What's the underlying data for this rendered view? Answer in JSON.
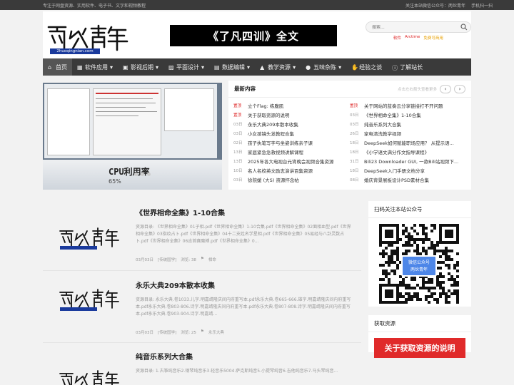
{
  "topbar": {
    "left": "专注于网盘资源、实用软件、电子书、文字和视频教程",
    "wechat": "关注本站微信公众号：两伙青年",
    "mobile": "手机扫一扫"
  },
  "header": {
    "logo_text": "两伙青年",
    "logo_sub": "2huoqingnian.com",
    "banner": "《了凡四训》全文",
    "search_placeholder": "搜索...",
    "hot_tags": [
      "软件",
      "Arctime",
      "免费可商用"
    ]
  },
  "nav": [
    {
      "label": "首页",
      "icon": "home-icon",
      "caret": ""
    },
    {
      "label": "软件应用",
      "icon": "windows-icon",
      "caret": "▾"
    },
    {
      "label": "影视后期",
      "icon": "film-icon",
      "caret": "▾"
    },
    {
      "label": "平面设计",
      "icon": "image-icon",
      "caret": "▾"
    },
    {
      "label": "数据编辑",
      "icon": "table-icon",
      "caret": "▾"
    },
    {
      "label": "教学资源",
      "icon": "graduation-icon",
      "caret": "▾"
    },
    {
      "label": "五味杂陈",
      "icon": "apple-icon",
      "caret": "▾"
    },
    {
      "label": "经验之谈",
      "icon": "hand-icon",
      "caret": ""
    },
    {
      "label": "了解站长",
      "icon": "info-icon",
      "caret": ""
    }
  ],
  "slider": {
    "caption": "CPU利用率",
    "caption_sub": "65%"
  },
  "latest": {
    "title": "最新内容",
    "hint": "点击左右箭头查看更多",
    "prev": "‹",
    "next": "›",
    "left": [
      {
        "date": "置顶",
        "top": true,
        "title": "立个Flag: 练腹肌"
      },
      {
        "date": "置顶",
        "top": true,
        "title": "关于获取资源的说明"
      },
      {
        "date": "03日",
        "top": false,
        "title": "永乐大典209本散本收集"
      },
      {
        "date": "03日",
        "top": false,
        "title": "小女孩镜头发教程合集"
      },
      {
        "date": "02日",
        "top": false,
        "title": "孩子执笔写字与坐姿训练亲子课"
      },
      {
        "date": "13日",
        "top": false,
        "title": "家庭紧急急救视频讲解课程"
      },
      {
        "date": "13日",
        "top": false,
        "title": "2025年各大电视台元宵晚会视频合集资源"
      },
      {
        "date": "10日",
        "top": false,
        "title": "名人名校英文励志演讲百集资源"
      },
      {
        "date": "03日",
        "top": false,
        "title": "徐院媛 (大S) 资源怀念帖"
      }
    ],
    "right": [
      {
        "date": "置顶",
        "top": true,
        "title": "关于网站的蓝奏云分享链接打不开问题"
      },
      {
        "date": "03日",
        "top": false,
        "title": "《世界相命全集》1-10合集"
      },
      {
        "date": "03日",
        "top": false,
        "title": "纯音乐系列大合集"
      },
      {
        "date": "26日",
        "top": false,
        "title": "家电清洗教学视频"
      },
      {
        "date": "18日",
        "top": false,
        "title": "DeepSeek如何赋能职场应用？ 从提示语..."
      },
      {
        "date": "18日",
        "top": false,
        "title": "《小学语文满分作文指导课程》"
      },
      {
        "date": "31日",
        "top": false,
        "title": "Bili23 Downloader GUI, 一款Bili站视频下..."
      },
      {
        "date": "18日",
        "top": false,
        "title": "DeepSeek入门手册文档分享"
      },
      {
        "date": "08日",
        "top": false,
        "title": "婚庆背景展板设计PSD素材合集"
      }
    ]
  },
  "posts": [
    {
      "title": "《世界相命全集》1-10合集",
      "excerpt": "资源目录: 《世界相命全集》01子相.pdf《世界相命全集》1-10合集.pdf《世界相命全集》02面相血型.pdf《世界相命全集》03指纹占卜.pdf《世界相命全集》04十二支姓名学星相.pdf《世界相命全集》05易经与八卦灵数占卜.pdf《世界相命全集》06吉首赛魔搏.pdf《世界相命全集》0...",
      "date": "03月03日",
      "category": "[传统国学]",
      "views": "浏览: 38",
      "tag": "相命"
    },
    {
      "title": "永乐大典209本散本收集",
      "excerpt": "资源目录: 永乐大典.卷1033.儿字.明嘉靖隆庆间内府重写本.pdf永乐大典.卷665-666.雄字.明嘉靖隆庆间内府重写本.pdf永乐大典.卷803-806.诗字.明嘉靖隆庆间内府重写本.pdf永乐大典.卷807-808.诗字.明嘉靖隆庆间内府重写本.pdf永乐大典.卷903-904.诗字.明嘉靖...",
      "date": "03月03日",
      "category": "[传统国学]",
      "views": "浏览: 25",
      "tag": "永乐大典"
    },
    {
      "title": "纯音乐系列大合集",
      "excerpt": "资源目录: 1.古筝纯音乐2.钢琴纯音乐3.轻音乐5004.萨克斯纯音5.小提琴纯音6.吉他纯音乐7.马头琴纯音...",
      "date": "",
      "category": "",
      "views": "",
      "tag": ""
    }
  ],
  "sidebar": {
    "qr_title": "扫码关注本站公众号",
    "qr_caption_1": "微信公众号",
    "qr_caption_2": "两伙青年",
    "res_title": "获取资源",
    "res_button": "关于获取资源的说明"
  },
  "colors": {
    "accent": "#e02a2a",
    "nav_bg": "#3a3a3a",
    "top_red": "#dd2222"
  }
}
